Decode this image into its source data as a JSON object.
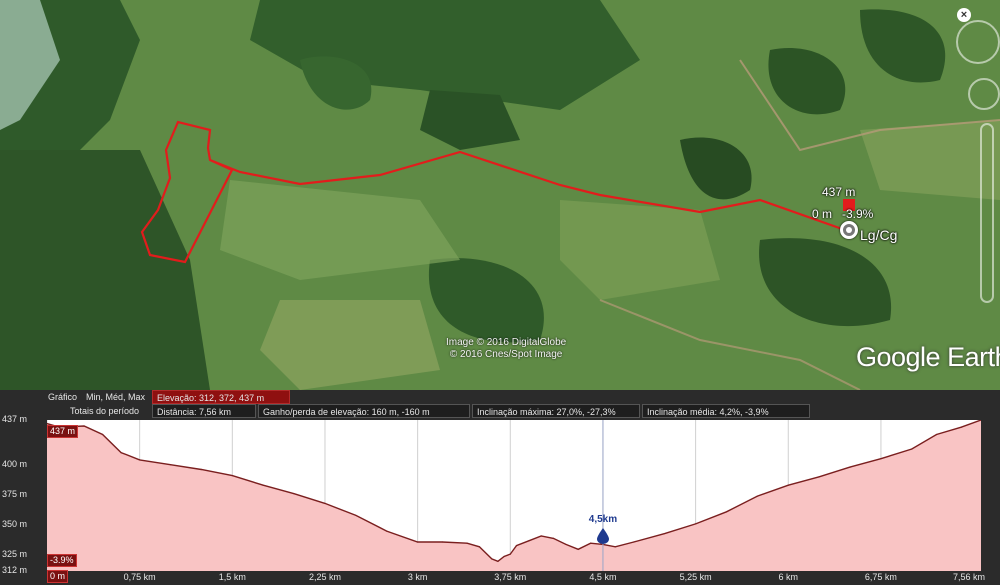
{
  "map": {
    "cursor": {
      "elevation": "437 m",
      "distance": "0 m",
      "slope": "-3.9%"
    },
    "place_label": "Lg/Cg",
    "copyright_lines": [
      "Image © 2016 DigitalGlobe",
      "© 2016 Cnes/Spot Image"
    ],
    "logo": "Google Earth",
    "path_color": "#e21c1c"
  },
  "stats": {
    "row1": {
      "chart_label": "Gráfico",
      "minmax_label": "Min, Méd, Max",
      "elevation": "Elevação: 312, 372, 437 m"
    },
    "row2": {
      "totals_label": "Totais do período",
      "distance": "Distância: 7,56 km",
      "gain_loss": "Ganho/perda de elevação: 160 m, -160 m",
      "max_slope": "Inclinação máxima: 27,0%, -27,3%",
      "avg_slope": "Inclinação média: 4,2%, -3,9%"
    }
  },
  "profile": {
    "current_elevation_tag": "437 m",
    "current_slope_tag": "-3.9%",
    "start_tag": "0 m",
    "marker": {
      "label": "4,5km",
      "km": 4.5
    },
    "fill_color": "#f9c4c4",
    "line_color": "#7a1f1f"
  },
  "chart_data": {
    "type": "area",
    "title": "",
    "xlabel": "",
    "ylabel": "",
    "x_unit": "km",
    "y_unit": "m",
    "xlim": [
      0,
      7.56
    ],
    "ylim": [
      312,
      437
    ],
    "y_ticks": [
      "437 m",
      "400 m",
      "375 m",
      "350 m",
      "325 m",
      "312 m"
    ],
    "y_tick_values": [
      437,
      400,
      375,
      350,
      325,
      312
    ],
    "x_ticks": [
      "0 m",
      "0,75 km",
      "1,5 km",
      "2,25 km",
      "3 km",
      "3,75 km",
      "4,5 km",
      "5,25 km",
      "6 km",
      "6,75 km",
      "7,56 km"
    ],
    "x_tick_values": [
      0,
      0.75,
      1.5,
      2.25,
      3,
      3.75,
      4.5,
      5.25,
      6,
      6.75,
      7.56
    ],
    "series": [
      {
        "x": [
          0,
          0.1,
          0.3,
          0.45,
          0.6,
          0.75,
          1.0,
          1.25,
          1.5,
          1.75,
          2.0,
          2.25,
          2.5,
          2.75,
          3.0,
          3.2,
          3.4,
          3.5,
          3.6,
          3.65,
          3.7,
          3.75,
          3.8,
          3.9,
          4.0,
          4.1,
          4.2,
          4.3,
          4.4,
          4.5,
          4.6,
          4.75,
          5.0,
          5.25,
          5.5,
          5.75,
          6.0,
          6.25,
          6.5,
          6.75,
          7.0,
          7.2,
          7.4,
          7.56
        ],
        "y": [
          434,
          431,
          432,
          425,
          410,
          404,
          400,
          396,
          391,
          383,
          376,
          368,
          358,
          345,
          336,
          336,
          335,
          332,
          322,
          320,
          324,
          326,
          333,
          337,
          341,
          339,
          334,
          330,
          335,
          334,
          332,
          336,
          343,
          351,
          361,
          374,
          383,
          390,
          398,
          405,
          413,
          425,
          431,
          437
        ]
      }
    ]
  }
}
